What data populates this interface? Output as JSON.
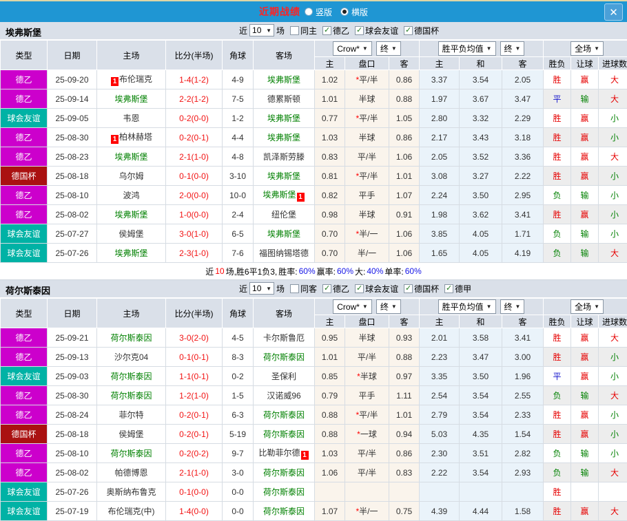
{
  "titlebar": {
    "title": "近期战绩",
    "options": [
      {
        "label": "竖版",
        "selected": false
      },
      {
        "label": "横版",
        "selected": true
      }
    ],
    "close_label": "✕"
  },
  "colors": {
    "titlebar_bg": "#1f96d3",
    "red": "#e60000",
    "blue": "#1414cc",
    "green": "#008000",
    "score_red": "#f21212",
    "team_green": "#008000",
    "header_bg": "#dae0e9",
    "cream_col": "#faf4ec",
    "blue_col": "#eaf3fa",
    "alt_row": "#ededed",
    "league": {
      "德乙": "#cc00cc",
      "球会友谊": "#00b2a5",
      "德国杯": "#aa1111"
    }
  },
  "table_header": {
    "col_type": "类型",
    "col_date": "日期",
    "col_home": "主场",
    "col_score": "比分(半场)",
    "col_corner": "角球",
    "col_away": "客场",
    "dd_bookmaker": "Crow*",
    "dd_final1": "终",
    "dd_avg": "胜平负均值",
    "dd_final2": "终",
    "dd_fulltime": "全场",
    "sub": [
      "主",
      "盘口",
      "客",
      "主",
      "和",
      "客",
      "胜负",
      "让球",
      "进球数"
    ]
  },
  "sections": [
    {
      "team": "埃弗斯堡",
      "filter": {
        "near": "近",
        "count": "10",
        "unit": "场",
        "same": {
          "label": "同主",
          "checked": false
        },
        "leagues": [
          {
            "label": "德乙",
            "checked": true
          },
          {
            "label": "球会友谊",
            "checked": true
          },
          {
            "label": "德国杯",
            "checked": true
          }
        ]
      },
      "rows": [
        {
          "type": "德乙",
          "date": "25-09-20",
          "home": {
            "name": "布伦瑞克",
            "green": false,
            "badge": "1",
            "badge_side": "left"
          },
          "score": "1-4",
          "half": "(1-2)",
          "corners": "4-9",
          "away": {
            "name": "埃弗斯堡",
            "green": true
          },
          "odds": {
            "home": "1.02",
            "handicap": "平/半",
            "star": true,
            "away": "0.86"
          },
          "avg": {
            "home": "3.37",
            "draw": "3.54",
            "away": "2.05"
          },
          "result": {
            "wdl": "胜",
            "handicap": "赢",
            "ou": "大"
          }
        },
        {
          "type": "德乙",
          "date": "25-09-14",
          "home": {
            "name": "埃弗斯堡",
            "green": true
          },
          "score": "2-2",
          "half": "(1-2)",
          "corners": "7-5",
          "away": {
            "name": "德累斯顿",
            "green": false
          },
          "odds": {
            "home": "1.01",
            "handicap": "半球",
            "star": false,
            "away": "0.88"
          },
          "avg": {
            "home": "1.97",
            "draw": "3.67",
            "away": "3.47"
          },
          "result": {
            "wdl": "平",
            "handicap": "输",
            "ou": "大"
          }
        },
        {
          "type": "球会友谊",
          "date": "25-09-05",
          "home": {
            "name": "韦恩",
            "green": false
          },
          "score": "0-2",
          "half": "(0-0)",
          "corners": "1-2",
          "away": {
            "name": "埃弗斯堡",
            "green": true
          },
          "odds": {
            "home": "0.77",
            "handicap": "平/半",
            "star": true,
            "away": "1.05"
          },
          "avg": {
            "home": "2.80",
            "draw": "3.32",
            "away": "2.29"
          },
          "result": {
            "wdl": "胜",
            "handicap": "赢",
            "ou": "小"
          }
        },
        {
          "type": "德乙",
          "date": "25-08-30",
          "home": {
            "name": "柏林赫塔",
            "green": false,
            "badge": "1",
            "badge_side": "left"
          },
          "score": "0-2",
          "half": "(0-1)",
          "corners": "4-4",
          "away": {
            "name": "埃弗斯堡",
            "green": true
          },
          "odds": {
            "home": "1.03",
            "handicap": "半球",
            "star": false,
            "away": "0.86"
          },
          "avg": {
            "home": "2.17",
            "draw": "3.43",
            "away": "3.18"
          },
          "result": {
            "wdl": "胜",
            "handicap": "赢",
            "ou": "小"
          }
        },
        {
          "type": "德乙",
          "date": "25-08-23",
          "home": {
            "name": "埃弗斯堡",
            "green": true
          },
          "score": "2-1",
          "half": "(1-0)",
          "corners": "4-8",
          "away": {
            "name": "凯泽斯劳滕",
            "green": false
          },
          "odds": {
            "home": "0.83",
            "handicap": "平/半",
            "star": false,
            "away": "1.06"
          },
          "avg": {
            "home": "2.05",
            "draw": "3.52",
            "away": "3.36"
          },
          "result": {
            "wdl": "胜",
            "handicap": "赢",
            "ou": "大"
          }
        },
        {
          "type": "德国杯",
          "date": "25-08-18",
          "home": {
            "name": "乌尔姆",
            "green": false
          },
          "score": "0-1",
          "half": "(0-0)",
          "corners": "3-10",
          "away": {
            "name": "埃弗斯堡",
            "green": true
          },
          "odds": {
            "home": "0.81",
            "handicap": "平/半",
            "star": true,
            "away": "1.01"
          },
          "avg": {
            "home": "3.08",
            "draw": "3.27",
            "away": "2.22"
          },
          "result": {
            "wdl": "胜",
            "handicap": "赢",
            "ou": "小"
          }
        },
        {
          "type": "德乙",
          "date": "25-08-10",
          "home": {
            "name": "波鸿",
            "green": false
          },
          "score": "2-0",
          "half": "(0-0)",
          "corners": "10-0",
          "away": {
            "name": "埃弗斯堡",
            "green": true,
            "badge": "1",
            "badge_side": "right"
          },
          "odds": {
            "home": "0.82",
            "handicap": "平手",
            "star": false,
            "away": "1.07"
          },
          "avg": {
            "home": "2.24",
            "draw": "3.50",
            "away": "2.95"
          },
          "result": {
            "wdl": "负",
            "handicap": "输",
            "ou": "小"
          }
        },
        {
          "type": "德乙",
          "date": "25-08-02",
          "home": {
            "name": "埃弗斯堡",
            "green": true
          },
          "score": "1-0",
          "half": "(0-0)",
          "corners": "2-4",
          "away": {
            "name": "纽伦堡",
            "green": false
          },
          "odds": {
            "home": "0.98",
            "handicap": "半球",
            "star": false,
            "away": "0.91"
          },
          "avg": {
            "home": "1.98",
            "draw": "3.62",
            "away": "3.41"
          },
          "result": {
            "wdl": "胜",
            "handicap": "赢",
            "ou": "小"
          }
        },
        {
          "type": "球会友谊",
          "date": "25-07-27",
          "home": {
            "name": "侯姆堡",
            "green": false
          },
          "score": "3-0",
          "half": "(1-0)",
          "corners": "6-5",
          "away": {
            "name": "埃弗斯堡",
            "green": true
          },
          "odds": {
            "home": "0.70",
            "handicap": "半/一",
            "star": true,
            "away": "1.06"
          },
          "avg": {
            "home": "3.85",
            "draw": "4.05",
            "away": "1.71"
          },
          "result": {
            "wdl": "负",
            "handicap": "输",
            "ou": "小"
          }
        },
        {
          "type": "球会友谊",
          "date": "25-07-26",
          "home": {
            "name": "埃弗斯堡",
            "green": true
          },
          "score": "2-3",
          "half": "(1-0)",
          "corners": "7-6",
          "away": {
            "name": "福图纳锡塔德",
            "green": false
          },
          "odds": {
            "home": "0.70",
            "handicap": "半/一",
            "star": false,
            "away": "1.06"
          },
          "avg": {
            "home": "1.65",
            "draw": "4.05",
            "away": "4.19"
          },
          "result": {
            "wdl": "负",
            "handicap": "输",
            "ou": "大"
          }
        }
      ],
      "summary": {
        "prefix": "近",
        "count": "10",
        "middle": "场,胜6平1负3, ",
        "stats": [
          {
            "label": "胜率:",
            "value": "60%"
          },
          {
            "label": "赢率:",
            "value": "60%"
          },
          {
            "label": "大:",
            "value": "40%"
          },
          {
            "label": "单率:",
            "value": "60%"
          }
        ]
      }
    },
    {
      "team": "荷尔斯泰因",
      "filter": {
        "near": "近",
        "count": "10",
        "unit": "场",
        "same": {
          "label": "同客",
          "checked": false
        },
        "leagues": [
          {
            "label": "德乙",
            "checked": true
          },
          {
            "label": "球会友谊",
            "checked": true
          },
          {
            "label": "德国杯",
            "checked": true
          },
          {
            "label": "德甲",
            "checked": true
          }
        ]
      },
      "rows": [
        {
          "type": "德乙",
          "date": "25-09-21",
          "home": {
            "name": "荷尔斯泰因",
            "green": true
          },
          "score": "3-0",
          "half": "(2-0)",
          "corners": "4-5",
          "away": {
            "name": "卡尔斯鲁厄",
            "green": false
          },
          "odds": {
            "home": "0.95",
            "handicap": "半球",
            "star": false,
            "away": "0.93"
          },
          "avg": {
            "home": "2.01",
            "draw": "3.58",
            "away": "3.41"
          },
          "result": {
            "wdl": "胜",
            "handicap": "赢",
            "ou": "大"
          }
        },
        {
          "type": "德乙",
          "date": "25-09-13",
          "home": {
            "name": "沙尔克04",
            "green": false
          },
          "score": "0-1",
          "half": "(0-1)",
          "corners": "8-3",
          "away": {
            "name": "荷尔斯泰因",
            "green": true
          },
          "odds": {
            "home": "1.01",
            "handicap": "平/半",
            "star": false,
            "away": "0.88"
          },
          "avg": {
            "home": "2.23",
            "draw": "3.47",
            "away": "3.00"
          },
          "result": {
            "wdl": "胜",
            "handicap": "赢",
            "ou": "小"
          }
        },
        {
          "type": "球会友谊",
          "date": "25-09-03",
          "home": {
            "name": "荷尔斯泰因",
            "green": true
          },
          "score": "1-1",
          "half": "(0-1)",
          "corners": "0-2",
          "away": {
            "name": "圣保利",
            "green": false
          },
          "odds": {
            "home": "0.85",
            "handicap": "半球",
            "star": true,
            "away": "0.97"
          },
          "avg": {
            "home": "3.35",
            "draw": "3.50",
            "away": "1.96"
          },
          "result": {
            "wdl": "平",
            "handicap": "赢",
            "ou": "小"
          }
        },
        {
          "type": "德乙",
          "date": "25-08-30",
          "home": {
            "name": "荷尔斯泰因",
            "green": true
          },
          "score": "1-2",
          "half": "(1-0)",
          "corners": "1-5",
          "away": {
            "name": "汉诺威96",
            "green": false
          },
          "odds": {
            "home": "0.79",
            "handicap": "平手",
            "star": false,
            "away": "1.11"
          },
          "avg": {
            "home": "2.54",
            "draw": "3.54",
            "away": "2.55"
          },
          "result": {
            "wdl": "负",
            "handicap": "输",
            "ou": "大"
          }
        },
        {
          "type": "德乙",
          "date": "25-08-24",
          "home": {
            "name": "菲尔特",
            "green": false
          },
          "score": "0-2",
          "half": "(0-1)",
          "corners": "6-3",
          "away": {
            "name": "荷尔斯泰因",
            "green": true
          },
          "odds": {
            "home": "0.88",
            "handicap": "平/半",
            "star": true,
            "away": "1.01"
          },
          "avg": {
            "home": "2.79",
            "draw": "3.54",
            "away": "2.33"
          },
          "result": {
            "wdl": "胜",
            "handicap": "赢",
            "ou": "小"
          }
        },
        {
          "type": "德国杯",
          "date": "25-08-18",
          "home": {
            "name": "侯姆堡",
            "green": false
          },
          "score": "0-2",
          "half": "(0-1)",
          "corners": "5-19",
          "away": {
            "name": "荷尔斯泰因",
            "green": true
          },
          "odds": {
            "home": "0.88",
            "handicap": "一球",
            "star": true,
            "away": "0.94"
          },
          "avg": {
            "home": "5.03",
            "draw": "4.35",
            "away": "1.54"
          },
          "result": {
            "wdl": "胜",
            "handicap": "赢",
            "ou": "小"
          }
        },
        {
          "type": "德乙",
          "date": "25-08-10",
          "home": {
            "name": "荷尔斯泰因",
            "green": true
          },
          "score": "0-2",
          "half": "(0-2)",
          "corners": "9-7",
          "away": {
            "name": "比勒菲尔德",
            "green": false,
            "badge": "1",
            "badge_side": "right"
          },
          "odds": {
            "home": "1.03",
            "handicap": "平/半",
            "star": false,
            "away": "0.86"
          },
          "avg": {
            "home": "2.30",
            "draw": "3.51",
            "away": "2.82"
          },
          "result": {
            "wdl": "负",
            "handicap": "输",
            "ou": "小"
          }
        },
        {
          "type": "德乙",
          "date": "25-08-02",
          "home": {
            "name": "帕德博恩",
            "green": false
          },
          "score": "2-1",
          "half": "(1-0)",
          "corners": "3-0",
          "away": {
            "name": "荷尔斯泰因",
            "green": true
          },
          "odds": {
            "home": "1.06",
            "handicap": "平/半",
            "star": false,
            "away": "0.83"
          },
          "avg": {
            "home": "2.22",
            "draw": "3.54",
            "away": "2.93"
          },
          "result": {
            "wdl": "负",
            "handicap": "输",
            "ou": "大"
          }
        },
        {
          "type": "球会友谊",
          "date": "25-07-26",
          "home": {
            "name": "奥斯纳布鲁克",
            "green": false
          },
          "score": "0-1",
          "half": "(0-0)",
          "corners": "0-0",
          "away": {
            "name": "荷尔斯泰因",
            "green": true
          },
          "odds": null,
          "avg": null,
          "result": {
            "wdl": "胜",
            "handicap": "",
            "ou": ""
          }
        },
        {
          "type": "球会友谊",
          "date": "25-07-19",
          "home": {
            "name": "布伦瑞克(中)",
            "green": false
          },
          "score": "1-4",
          "half": "(0-0)",
          "corners": "0-0",
          "away": {
            "name": "荷尔斯泰因",
            "green": true
          },
          "odds": {
            "home": "1.07",
            "handicap": "半/一",
            "star": true,
            "away": "0.75"
          },
          "avg": {
            "home": "4.39",
            "draw": "4.44",
            "away": "1.58"
          },
          "result": {
            "wdl": "胜",
            "handicap": "赢",
            "ou": "大"
          }
        }
      ],
      "summary": null
    }
  ]
}
